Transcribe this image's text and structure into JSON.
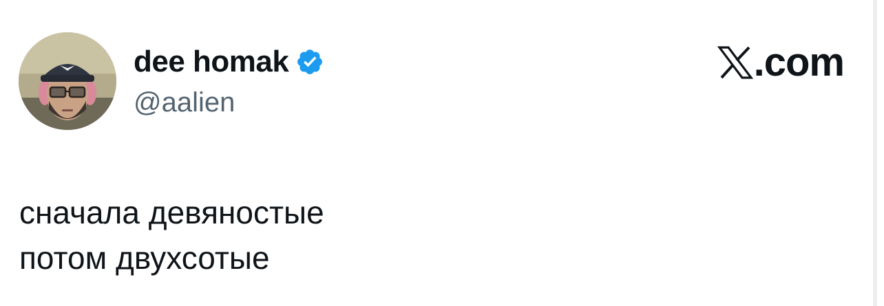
{
  "author": {
    "display_name": "dee homak",
    "handle": "@aalien",
    "verified_icon": "verified-badge-icon",
    "avatar_icon": "avatar-photo"
  },
  "brand": {
    "logo_icon": "x-logo-icon",
    "text": ".com"
  },
  "tweet": {
    "lines": [
      "сначала девяностые",
      "потом двухсотые"
    ]
  },
  "colors": {
    "text": "#0f1419",
    "secondary": "#536471",
    "verified": "#1d9bf0",
    "background": "#ffffff"
  }
}
